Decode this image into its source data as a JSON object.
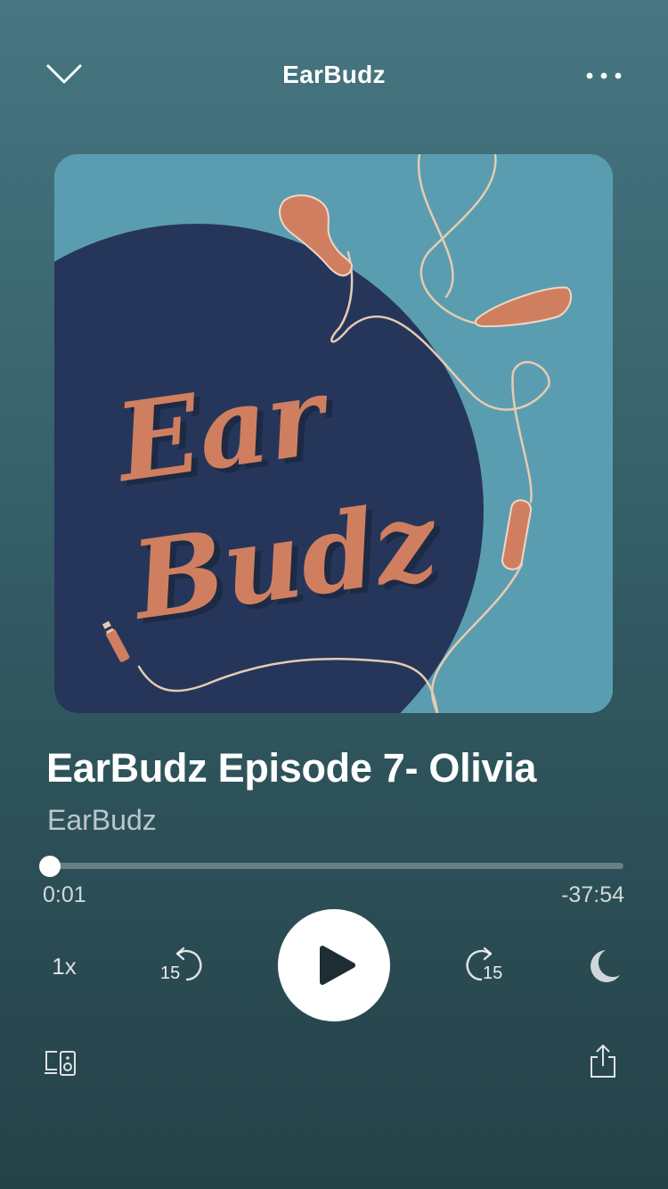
{
  "header": {
    "title": "EarBudz",
    "collapse_icon": "chevron-down-icon",
    "menu_icon": "more-horizontal-icon"
  },
  "artwork": {
    "text_line1": "Ear",
    "text_line2": "Budz",
    "colors": {
      "background": "#5b9db0",
      "circle": "#26365a",
      "accent": "#cf7f60",
      "wire": "#e6cbb0"
    }
  },
  "episode": {
    "title": "EarBudz Episode 7- Olivia",
    "show": "EarBudz"
  },
  "progress": {
    "elapsed": "0:01",
    "remaining": "-37:54",
    "fraction": 0.0004
  },
  "controls": {
    "speed_label": "1x",
    "skip_back_label": "15",
    "skip_forward_label": "15",
    "skip_back_icon": "rewind-15-icon",
    "play_icon": "play-icon",
    "skip_forward_icon": "forward-15-icon",
    "sleep_icon": "moon-icon",
    "devices_icon": "devices-icon",
    "share_icon": "share-icon"
  }
}
